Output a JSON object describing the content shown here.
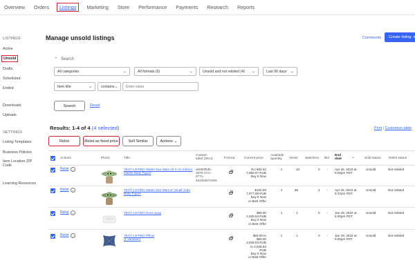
{
  "topnav": {
    "items": [
      "Overview",
      "Orders",
      "Listings",
      "Marketing",
      "Store",
      "Performance",
      "Payments",
      "Research",
      "Reports"
    ]
  },
  "sidebar": {
    "listings_head": "LISTINGS",
    "active": "Active",
    "unsold": "Unsold",
    "drafts": "Drafts",
    "scheduled": "Scheduled",
    "ended": "Ended",
    "downloads": "Downloads",
    "uploads": "Uploads",
    "settings_head": "SETTINGS",
    "listing_templates": "Listing Templates",
    "business_policies": "Business Policies",
    "item_location": "Item Location ZIP Code",
    "learning_resources": "Learning Resources"
  },
  "header": {
    "title": "Manage unsold listings",
    "comments": "Comments",
    "create_listing": "Create listing"
  },
  "search": {
    "toggle_label": "Search",
    "category": "All categories",
    "formats": "All formats (6)",
    "relist_status": "Unsold and not relisted (4)",
    "period": "Last 90 days",
    "field": "Item title",
    "operator": "contains",
    "value_placeholder": "Enter value",
    "search_button": "Search",
    "reset": "Reset"
  },
  "results": {
    "title": "Results: 1-4 of 4",
    "selected": "(4 selected)",
    "print": "Print",
    "customize": "Customize table",
    "relist": "Relist",
    "relist_fixed": "Relist as fixed price",
    "sell_similar": "Sell Similar",
    "actions": "Actions"
  },
  "table": {
    "headers": {
      "actions": "Actions",
      "photo": "Photo",
      "title": "Title",
      "custom_label_1": "Custom",
      "custom_label_2": "label (SKU)",
      "format": "Format",
      "current_price": "Current price",
      "available_1": "Available",
      "available_2": "quantity",
      "views": "Views",
      "watchers": "Watchers",
      "bid": "Bid",
      "end_date_1": "End",
      "end_date_2": "date",
      "sold_status": "Sold status",
      "relist_status": "Relist status"
    },
    "rows": [
      {
        "action": "Relist",
        "title": "TEST LISTING Mattel Star Wars 20 3 cm Interior Visible Baby Figure",
        "sku_1": "a6598f9db-",
        "sku_2": "3879-47cc-",
        "sku_3": "9771-",
        "sku_4": "5310b0b7e255",
        "price_1": "EU €82.62",
        "price_2": "7,655.67 RUB",
        "price_3": "Buy It Now",
        "qty": "1",
        "views": "10",
        "watchers": "0",
        "bid": "-",
        "end_1": "Apr 25, 2022 at",
        "end_2": "6:00pm PDT",
        "sold": "Unsold",
        "relist": "Not relisted"
      },
      {
        "action": "Relist",
        "title": "TEST LISTING Mattel Star Wars 8\" Small Yoda Baby Figure",
        "sku_1": "",
        "sku_2": "",
        "sku_3": "",
        "sku_4": "",
        "price_1": "$100.00",
        "price_2": "7,677.88 RUB",
        "price_3": "Buy It Now",
        "price_4": "or Best Offer",
        "qty": "1",
        "views": "85",
        "watchers": "4",
        "bid": "-",
        "end_1": "Apr 25, 2022 at",
        "end_2": "5:37pm PDT",
        "sold": "Unsold",
        "relist": "Not relisted"
      },
      {
        "action": "Relist",
        "title": "TEST LISTING Dove soap",
        "price_1": "$50.00",
        "price_2": "2,635.53 RUB",
        "price_3": "Buy It Now",
        "price_4": "or Best Offer",
        "qty": "1",
        "views": "1",
        "watchers": "0",
        "bid": "-",
        "end_1": "Jan 29, 2022 at",
        "end_2": "6:00pm PDT",
        "sold": "Unsold",
        "relist": "Not relisted"
      },
      {
        "action": "Relist",
        "title": "TEST LISTING Pillow",
        "variation": "(1 variation)",
        "price_1": "$50.00 to",
        "price_2": "$50.00",
        "price_3": "2,635.53 RUB",
        "price_4": "to 2,635.53",
        "price_5": "RUB",
        "price_6": "Buy It Now",
        "price_7": "or Best Offer",
        "qty": "1",
        "views": "1",
        "watchers": "0",
        "bid": "-",
        "end_1": "Jan 29, 2022 at",
        "end_2": "6:00pm PDT",
        "sold": "Unsold",
        "relist": "Not relisted"
      }
    ]
  },
  "colors": {
    "accent": "#3665f3",
    "highlight": "#d0202e"
  }
}
